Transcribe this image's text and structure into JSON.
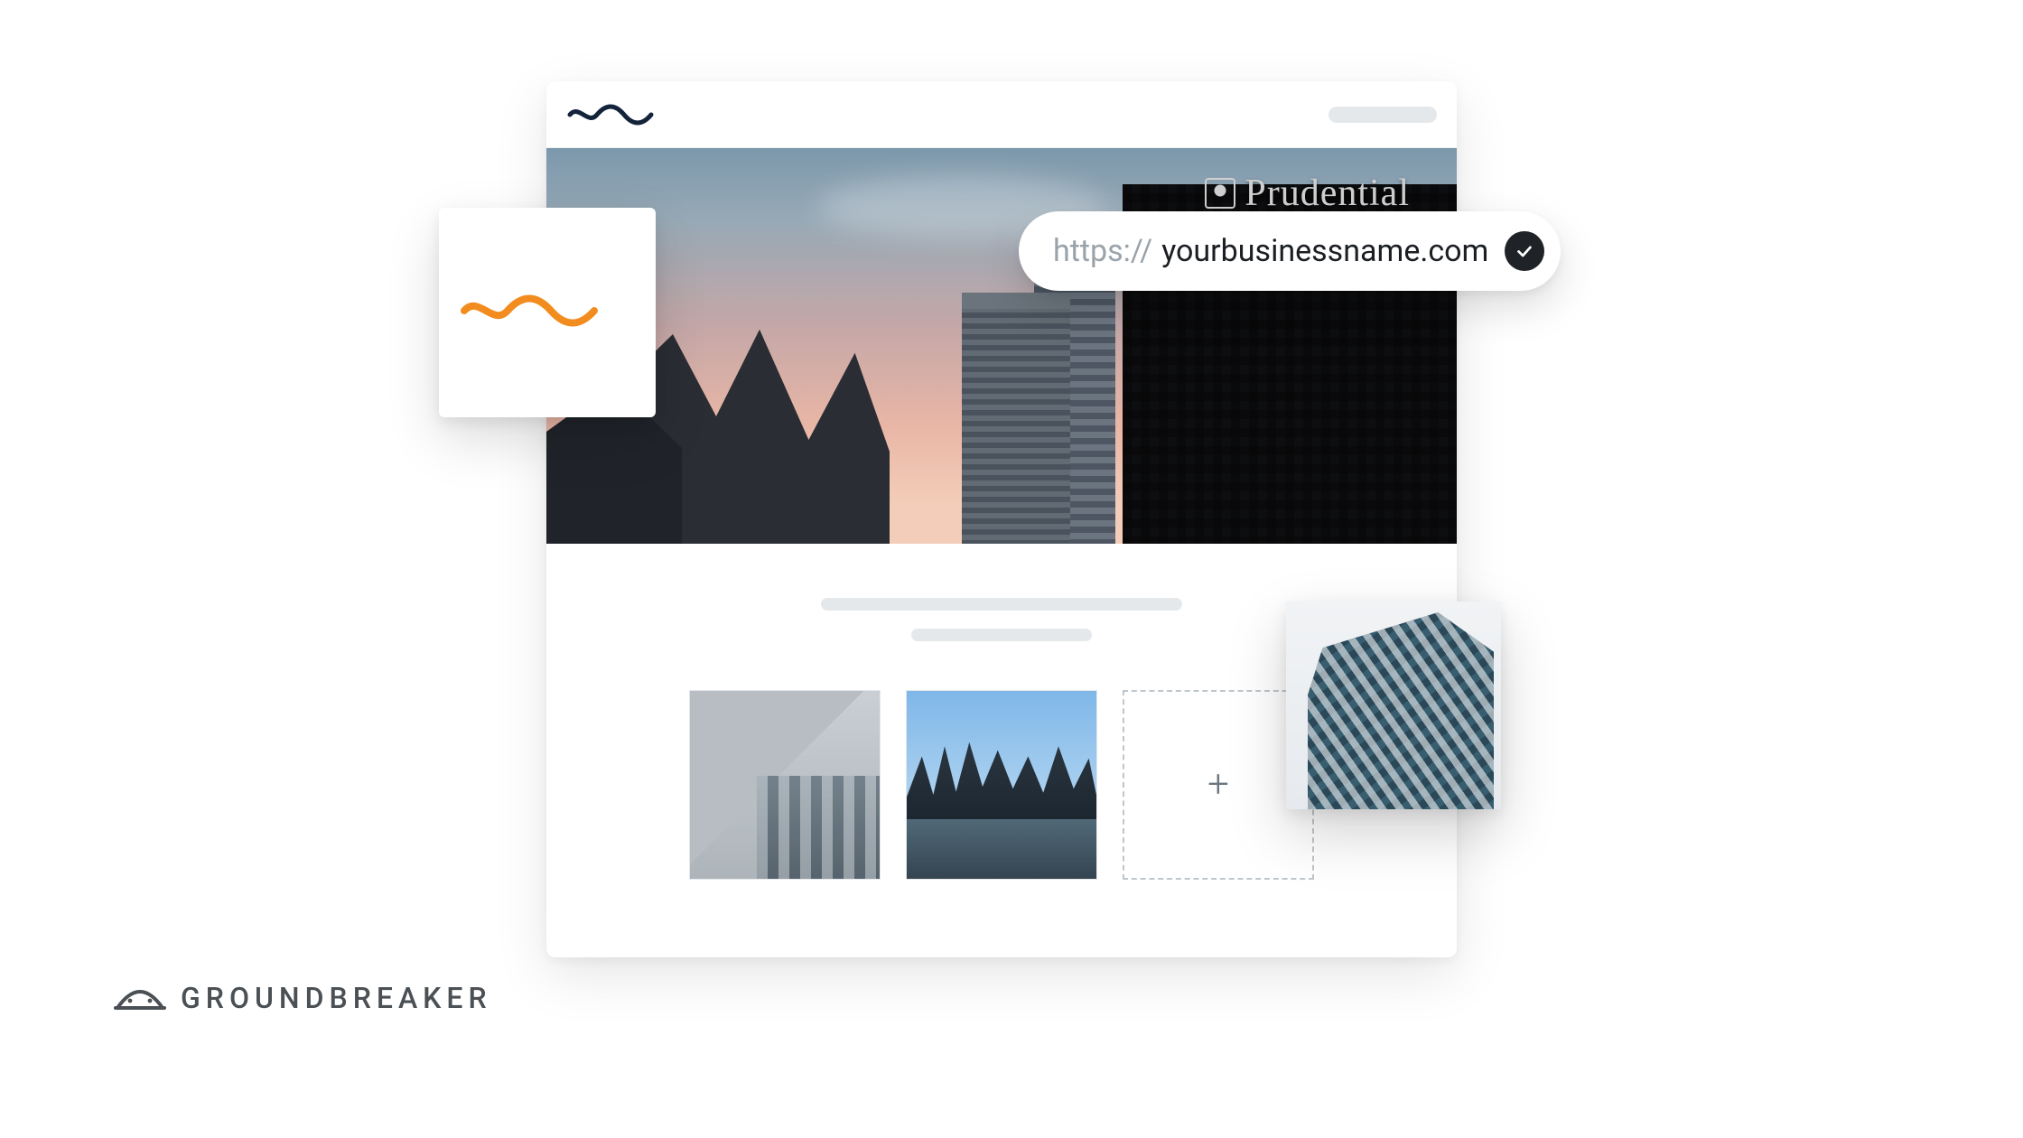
{
  "hero": {
    "signage_text": "Prudential"
  },
  "url_bar": {
    "scheme": "https://",
    "domain": "yourbusinessname.com"
  },
  "footer": {
    "brand_name": "GROUNDBREAKER"
  },
  "icons": {
    "add": "+"
  },
  "colors": {
    "accent": "#f28c1f",
    "header_wave": "#13233a"
  }
}
